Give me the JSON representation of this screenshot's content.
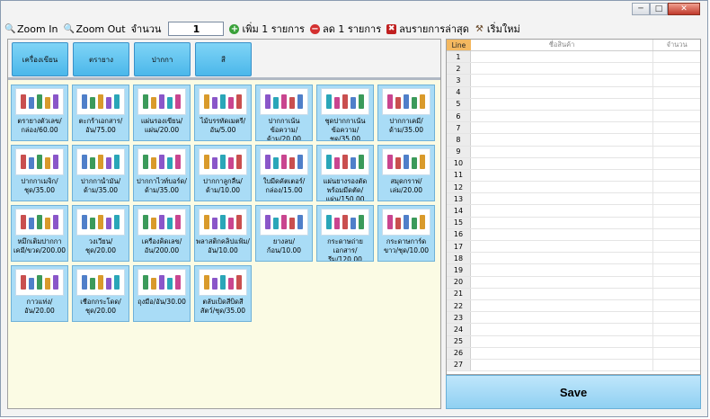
{
  "window": {
    "title_buttons": {
      "minimize": "─",
      "maximize": "□",
      "close": "✕"
    }
  },
  "toolbar": {
    "zoom_in": "Zoom In",
    "zoom_out": "Zoom Out",
    "qty_label": "จำนวน",
    "qty_value": "1",
    "add_one": "เพิ่ม 1 รายการ",
    "remove_one": "ลด 1 รายการ",
    "delete_last": "ลบรายการล่าสุด",
    "restart": "เริ่มใหม่"
  },
  "categories": [
    "เครื่องเขียน",
    "ตรายาง",
    "ปากกา",
    "สี"
  ],
  "products": [
    {
      "label": "ตรายางตัวเลข/กล่อง/60.00",
      "icon": "stamp-icon"
    },
    {
      "label": "ตะกร้าเอกสาร/อัน/75.00",
      "icon": "document-tray-icon"
    },
    {
      "label": "แผ่นรองเขียน/แผ่น/20.00",
      "icon": "writing-board-icon"
    },
    {
      "label": "ไม้บรรทัดเมตรี/อัน/5.00",
      "icon": "ruler-icon"
    },
    {
      "label": "ปากกาเน้นข้อความ/ด้าม/20.00",
      "icon": "highlighter-icon"
    },
    {
      "label": "ชุดปากกาเน้นข้อความ/ชุด/35.00",
      "icon": "highlighter-set-icon"
    },
    {
      "label": "ปากกาเคมี/ด้าม/35.00",
      "icon": "marker-icon"
    },
    {
      "label": "ปากกาเมจิก/ชุด/35.00",
      "icon": "magic-pen-icon"
    },
    {
      "label": "ปากกาน้ำมัน/ด้าม/35.00",
      "icon": "oil-pen-icon"
    },
    {
      "label": "ปากกาไวท์บอร์ด/ด้าม/35.00",
      "icon": "whiteboard-marker-icon"
    },
    {
      "label": "ปากกาลูกลื่น/ด้าม/10.00",
      "icon": "ballpoint-pen-icon"
    },
    {
      "label": "ใบมีดคัตเตอร์/กล่อง/15.00",
      "icon": "cutter-blade-icon"
    },
    {
      "label": "แผ่นยางรองตัดพร้อมมีดตัด/แผ่น/150.00",
      "icon": "cutting-mat-icon"
    },
    {
      "label": "สมุดกราฟ/เล่ม/20.00",
      "icon": "graph-notebook-icon"
    },
    {
      "label": "หมึกเติมปากกาเคมี/ขวด/200.00",
      "icon": "ink-refill-icon"
    },
    {
      "label": "วงเวียน/ชุด/20.00",
      "icon": "compass-icon"
    },
    {
      "label": "เครื่องคิดเลข/อัน/200.00",
      "icon": "calculator-icon"
    },
    {
      "label": "พลาสติกคลิปแฟ้ม/อัน/10.00",
      "icon": "plastic-folder-icon"
    },
    {
      "label": "ยางลบ/ก้อน/10.00",
      "icon": "eraser-icon"
    },
    {
      "label": "กระดาษถ่ายเอกสาร/รีม/120.00",
      "icon": "copy-paper-icon"
    },
    {
      "label": "กระดาษการ์ดขาว/ชุด/10.00",
      "icon": "white-card-icon"
    },
    {
      "label": "กาวแท่ง/อัน/20.00",
      "icon": "glue-stick-icon"
    },
    {
      "label": "เชือกกระโดด/ชุด/20.00",
      "icon": "jump-rope-icon"
    },
    {
      "label": "ถุงมือ/อัน/30.00",
      "icon": "gloves-icon"
    },
    {
      "label": "ตลับเป็ดสีบิดสีสัตว์/ชุด/35.00",
      "icon": "paint-jars-icon"
    }
  ],
  "order_table": {
    "headers": {
      "line": "Line",
      "name": "ชื่อสินค้า",
      "qty": "จำนวน"
    },
    "rows": [
      "1",
      "2",
      "3",
      "4",
      "5",
      "6",
      "7",
      "8",
      "9",
      "10",
      "11",
      "12",
      "13",
      "14",
      "15",
      "16",
      "17",
      "18",
      "19",
      "20",
      "21",
      "22",
      "23",
      "24",
      "25",
      "26",
      "27"
    ]
  },
  "save_label": "Save",
  "colors": {
    "button_blue": "#a9dcf6",
    "category_blue": "#4bb7ea",
    "header_orange": "#f4b860",
    "panel_cream": "#fbfbe4"
  }
}
